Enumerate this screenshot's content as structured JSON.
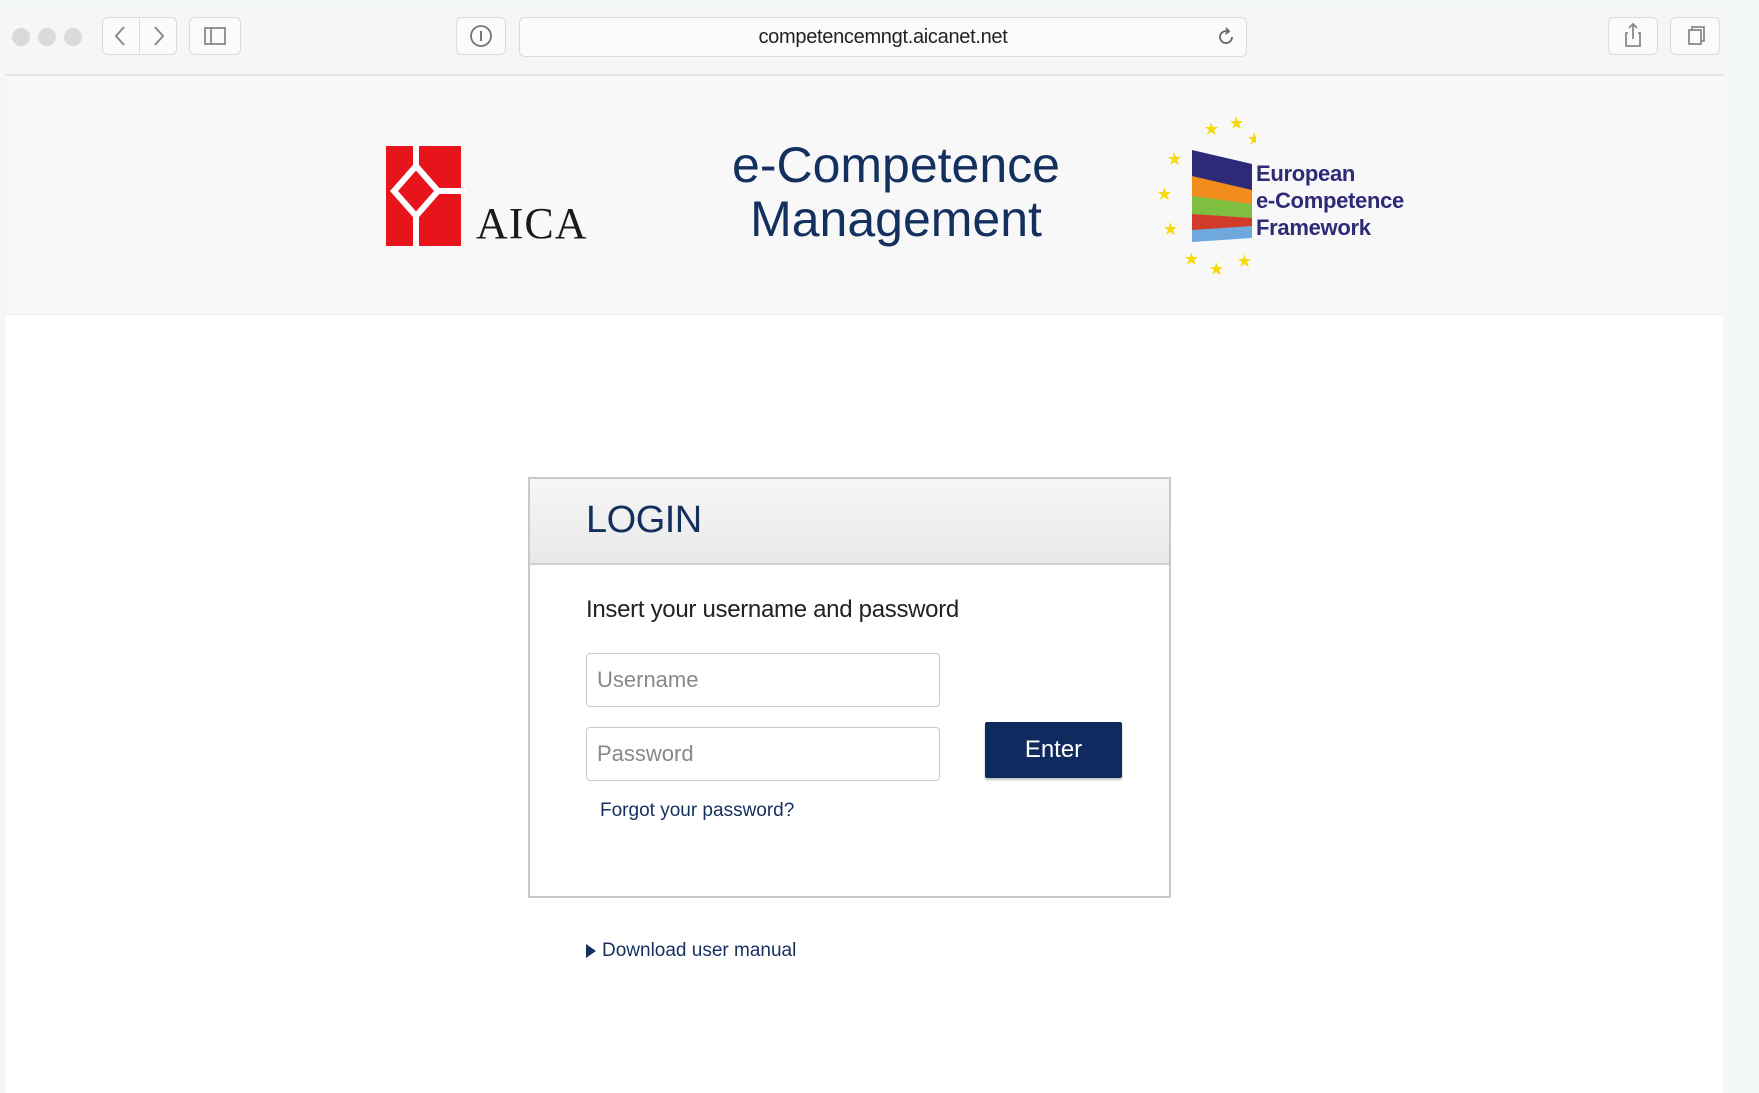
{
  "browser": {
    "url": "competencemngt.aicanet.net"
  },
  "header": {
    "aica_name": "AICA",
    "title_line1": "e-Competence",
    "title_line2": "Management",
    "ecf_line1": "European",
    "ecf_line2": "e-Competence",
    "ecf_line3": "Framework"
  },
  "login": {
    "title": "LOGIN",
    "instruction": "Insert your username and password",
    "username_placeholder": "Username",
    "password_placeholder": "Password",
    "enter_label": "Enter",
    "forgot_label": "Forgot your password?"
  },
  "links": {
    "download_manual": "Download user manual"
  },
  "colors": {
    "brand_navy": "#0f2a5e",
    "aica_red": "#e8141c"
  }
}
